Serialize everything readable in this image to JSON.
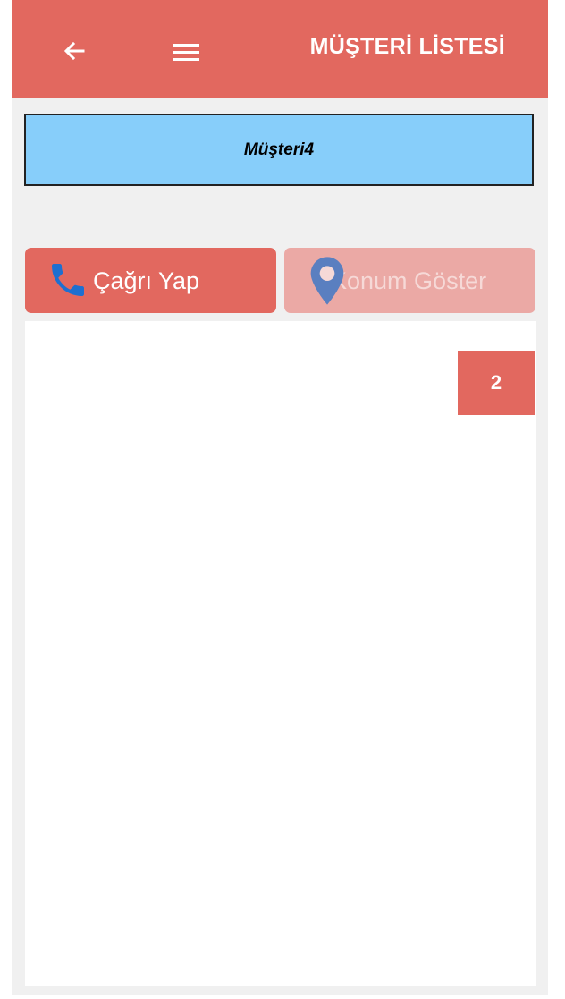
{
  "appbar": {
    "title": "MÜŞTERİ LİSTESİ",
    "back_icon": "arrow-left-icon",
    "menu_icon": "hamburger-menu-icon"
  },
  "customer": {
    "name": "Müşteri4"
  },
  "actions": {
    "call_label": "Çağrı Yap",
    "call_icon": "phone-icon",
    "location_label": "Konum Göster",
    "location_icon": "map-pin-icon"
  },
  "content": {
    "badge": "2"
  },
  "colors": {
    "primary": "#e2685f",
    "primary_disabled": "#eba9a5",
    "customer_box": "#87cefa",
    "phone_icon": "#1e6fd0",
    "pin_icon": "#5a7fc0",
    "background": "#f0f0f0"
  }
}
